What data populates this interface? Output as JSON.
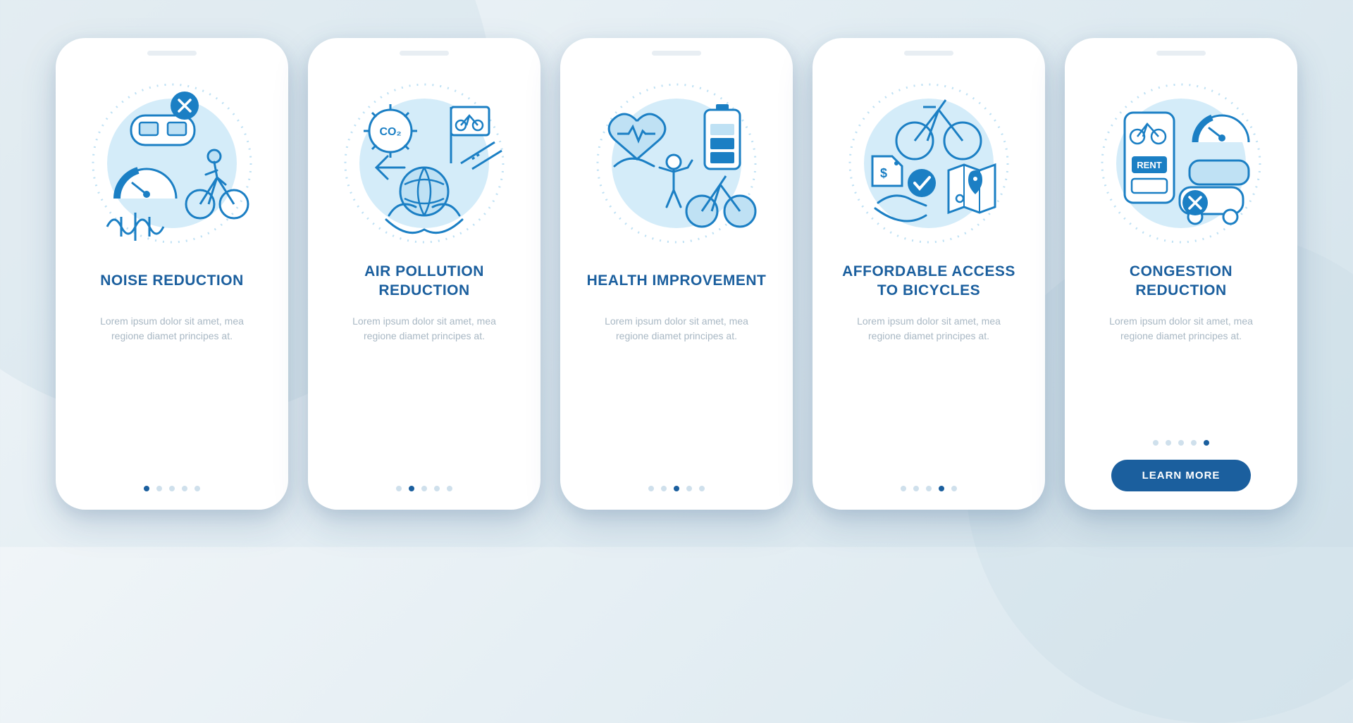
{
  "colors": {
    "primary": "#1b5f9e",
    "icon_stroke": "#1b7fc4",
    "icon_fill_light": "#bfe1f4",
    "dot_inactive": "#cfe0ec",
    "desc_text": "#a9b8c4"
  },
  "shared": {
    "description": "Lorem ipsum dolor sit amet, mea regione diamet principes at.",
    "total_slides": 5
  },
  "cards": [
    {
      "title": "NOISE REDUCTION",
      "active_dot_index": 0,
      "illustration": "noise-reduction",
      "last": false
    },
    {
      "title": "AIR POLLUTION REDUCTION",
      "active_dot_index": 1,
      "illustration": "air-pollution",
      "last": false
    },
    {
      "title": "HEALTH IMPROVEMENT",
      "active_dot_index": 2,
      "illustration": "health",
      "last": false
    },
    {
      "title": "AFFORDABLE ACCESS TO BICYCLES",
      "active_dot_index": 3,
      "illustration": "affordable",
      "last": false
    },
    {
      "title": "CONGESTION REDUCTION",
      "active_dot_index": 4,
      "illustration": "congestion",
      "last": true
    }
  ],
  "cta_label": "LEARN MORE"
}
